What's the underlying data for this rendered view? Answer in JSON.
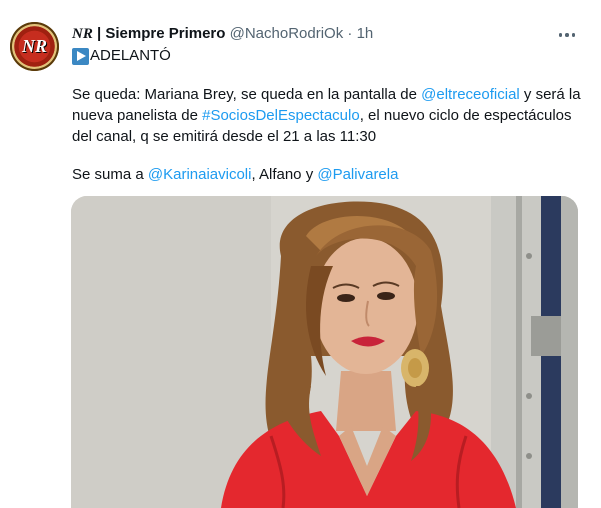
{
  "tweet": {
    "avatar_text": "NR",
    "author_prefix": "NR",
    "author_name": " | Siempre Primero",
    "handle": "@NachoRodriOk",
    "dot": "·",
    "time": "1h",
    "line1": "ADELANTÓ",
    "p1_a": "Se queda: Mariana Brey, se queda en la pantalla de ",
    "p1_m1": "@eltreceoficial",
    "p1_b": " y será la nueva panelista de ",
    "p1_m2": "#SociosDelEspectaculo",
    "p1_c": ", el nuevo ciclo de espectáculos del canal, q se emitirá desde el 21 a las 11:30",
    "p2_a": "Se suma a ",
    "p2_m1": "@Karinaiavicoli",
    "p2_b": ", Alfano y ",
    "p2_m2": "@Palivarela"
  },
  "icons": {
    "play": "play-button-icon",
    "more": "more-options-icon"
  },
  "colors": {
    "link": "#1d9bf0",
    "secondary": "#536471",
    "dress": "#e4282e"
  }
}
